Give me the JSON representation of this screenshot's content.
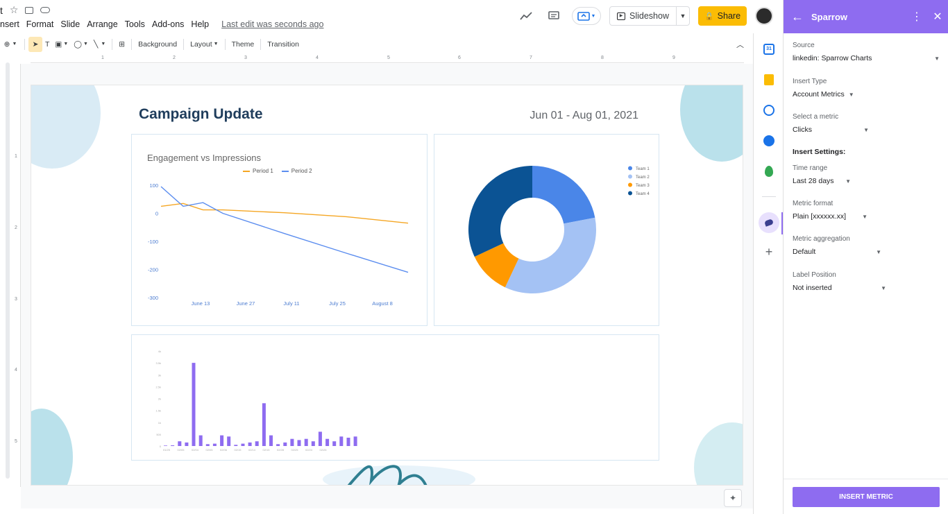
{
  "header": {
    "doc_title_fragment": "t",
    "menu": [
      "nsert",
      "Format",
      "Slide",
      "Arrange",
      "Tools",
      "Add-ons",
      "Help"
    ],
    "last_edit": "Last edit was seconds ago",
    "slideshow_label": "Slideshow",
    "share_label": "Share"
  },
  "toolbar": {
    "background_label": "Background",
    "layout_label": "Layout",
    "theme_label": "Theme",
    "transition_label": "Transition"
  },
  "ruler": {
    "h_ticks": [
      "1",
      "2",
      "3",
      "4",
      "5",
      "6",
      "7",
      "8",
      "9"
    ],
    "v_ticks": [
      "1",
      "2",
      "3",
      "4",
      "5"
    ]
  },
  "slide": {
    "title": "Campaign Update",
    "date_range": "Jun 01 - Aug 01, 2021",
    "line_chart_title": "Engagement vs Impressions"
  },
  "chart_data": [
    {
      "type": "line",
      "title": "Engagement vs Impressions",
      "x": [
        "June 13",
        "June 27",
        "July 11",
        "July 25",
        "August 8"
      ],
      "ylim": [
        -300,
        100
      ],
      "y_ticks": [
        "100",
        "0",
        "-100",
        "-200",
        "-300"
      ],
      "series": [
        {
          "name": "Period 1",
          "color": "#f5a623",
          "points": [
            [
              0,
              25
            ],
            [
              0.09,
              35
            ],
            [
              0.17,
              12
            ],
            [
              0.25,
              12
            ],
            [
              0.5,
              2
            ],
            [
              0.75,
              -12
            ],
            [
              1.0,
              -35
            ]
          ]
        },
        {
          "name": "Period 2",
          "color": "#5b8def",
          "points": [
            [
              0,
              95
            ],
            [
              0.09,
              25
            ],
            [
              0.17,
              38
            ],
            [
              0.25,
              0
            ],
            [
              0.5,
              -72
            ],
            [
              0.75,
              -142
            ],
            [
              1.0,
              -210
            ]
          ]
        }
      ]
    },
    {
      "type": "pie",
      "series": [
        {
          "name": "Team 1",
          "value": 22,
          "color": "#4a86e8"
        },
        {
          "name": "Team 2",
          "value": 35,
          "color": "#a4c2f4"
        },
        {
          "name": "Team 3",
          "value": 11,
          "color": "#ff9900"
        },
        {
          "name": "Team 4",
          "value": 32,
          "color": "#0b5394"
        }
      ]
    },
    {
      "type": "bar",
      "color": "#8e6cf0",
      "ylim": [
        0,
        4000
      ],
      "y_ticks": [
        "0",
        "500",
        "1k",
        "1.5k",
        "2k",
        "2.5k",
        "3k",
        "3.5k",
        "4k"
      ],
      "x_ticks": [
        "01/25",
        "02/05",
        "02/04",
        "02/05",
        "02/06",
        "02/15",
        "02/14",
        "02/15",
        "02/28",
        "02/25",
        "02/24",
        "02/26"
      ],
      "values": [
        20,
        30,
        200,
        150,
        3500,
        450,
        80,
        100,
        450,
        400,
        50,
        100,
        150,
        200,
        1800,
        450,
        80,
        150,
        300,
        250,
        300,
        200,
        600,
        300,
        200,
        400,
        350,
        400
      ]
    }
  ],
  "sidebar_panel": {
    "title": "Sparrow",
    "source_label": "Source",
    "source_value": "linkedin: Sparrow Charts",
    "insert_type_label": "Insert Type",
    "insert_type_value": "Account Metrics",
    "metric_label": "Select a metric",
    "metric_value": "Clicks",
    "settings_heading": "Insert Settings:",
    "time_range_label": "Time range",
    "time_range_value": "Last 28 days",
    "metric_format_label": "Metric format",
    "metric_format_value": "Plain [xxxxxx.xx]",
    "aggregation_label": "Metric aggregation",
    "aggregation_value": "Default",
    "label_position_label": "Label Position",
    "label_position_value": "Not inserted",
    "insert_button": "INSERT METRIC"
  },
  "colors": {
    "accent": "#8e6cf0",
    "share": "#fbbc04",
    "title": "#1f3d5c"
  }
}
